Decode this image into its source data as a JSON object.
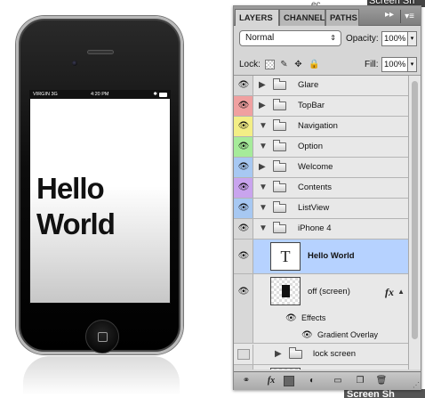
{
  "device": {
    "status_carrier": "VIRGIN  3G",
    "status_time": "4:20 PM",
    "screen_text_line1": "Hello",
    "screen_text_line2": "World"
  },
  "panel": {
    "tabs": [
      {
        "label": "LAYERS",
        "active": true
      },
      {
        "label": "CHANNELS",
        "active": false
      },
      {
        "label": "PATHS",
        "active": false
      }
    ],
    "blend_mode": "Normal",
    "opacity_label": "Opacity:",
    "opacity_value": "100%",
    "lock_label": "Lock:",
    "fill_label": "Fill:",
    "fill_value": "100%",
    "layers": [
      {
        "name": "Glare",
        "color": "#d8d8d8",
        "expanded": false,
        "visible": true
      },
      {
        "name": "TopBar",
        "color": "#f0a0a0",
        "expanded": false,
        "visible": true
      },
      {
        "name": "Navigation",
        "color": "#f3ee86",
        "expanded": true,
        "visible": true
      },
      {
        "name": "Option",
        "color": "#a6eb9a",
        "expanded": true,
        "visible": true
      },
      {
        "name": "Welcome",
        "color": "#a7c8f2",
        "expanded": false,
        "visible": true
      },
      {
        "name": "Contents",
        "color": "#c9a4ee",
        "expanded": true,
        "visible": true
      },
      {
        "name": "ListView",
        "color": "#a7c8f2",
        "expanded": true,
        "visible": true
      },
      {
        "name": "iPhone 4",
        "color": "#d8d8d8",
        "expanded": true,
        "visible": true
      }
    ],
    "text_layer_name": "Hello World",
    "text_layer_thumb": "T",
    "off_screen_name": "off (screen)",
    "fx_label": "fx",
    "effects_label": "Effects",
    "gradient_overlay_label": "Gradient Overlay",
    "lock_screen_name": "lock screen"
  },
  "peeks": {
    "top": "Screen Sh",
    "top_small": "ec",
    "bottom": "Screen Sh"
  },
  "colors": {
    "selection": "#b6d2ff"
  }
}
